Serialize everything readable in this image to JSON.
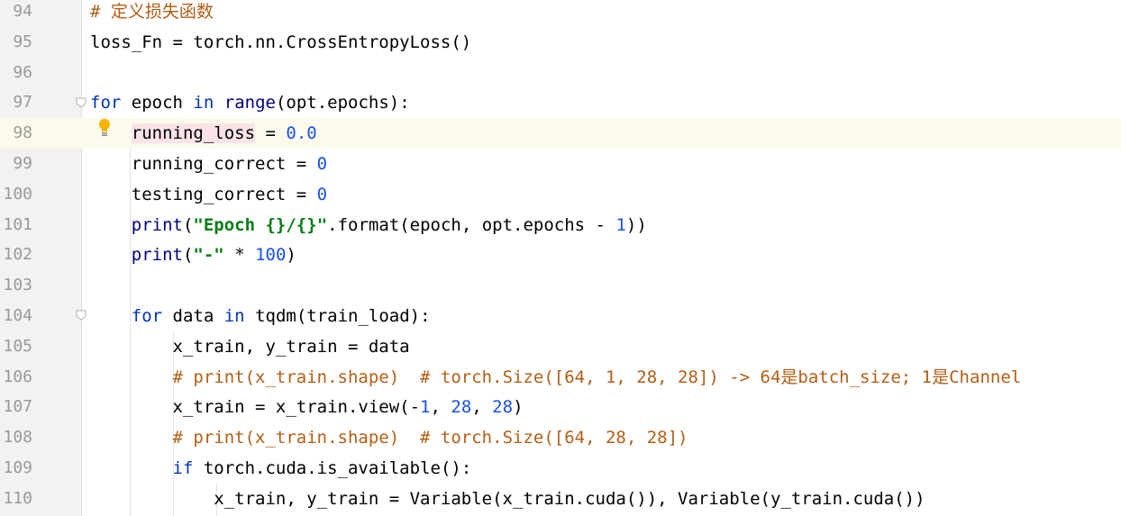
{
  "editor": {
    "lines": [
      {
        "no": "94",
        "tokens": [
          {
            "t": "# 定义损失函数",
            "c": "cm"
          }
        ]
      },
      {
        "no": "95",
        "tokens": [
          {
            "t": "loss_Fn = torch.nn.CrossEntropyLoss()",
            "c": ""
          }
        ]
      },
      {
        "no": "96",
        "tokens": []
      },
      {
        "no": "97",
        "tokens": [
          {
            "t": "for",
            "c": "kw"
          },
          {
            "t": " epoch ",
            "c": ""
          },
          {
            "t": "in",
            "c": "kw"
          },
          {
            "t": " ",
            "c": ""
          },
          {
            "t": "range",
            "c": "fn"
          },
          {
            "t": "(opt.epochs):",
            "c": ""
          }
        ]
      },
      {
        "no": "98",
        "tokens": [
          {
            "t": "    ",
            "c": ""
          },
          {
            "t": "running_loss",
            "c": "hl"
          },
          {
            "t": " = ",
            "c": ""
          },
          {
            "t": "0.0",
            "c": "num"
          }
        ]
      },
      {
        "no": "99",
        "tokens": [
          {
            "t": "    running_correct = ",
            "c": ""
          },
          {
            "t": "0",
            "c": "num"
          }
        ]
      },
      {
        "no": "100",
        "tokens": [
          {
            "t": "    testing_correct = ",
            "c": ""
          },
          {
            "t": "0",
            "c": "num"
          }
        ]
      },
      {
        "no": "101",
        "tokens": [
          {
            "t": "    ",
            "c": ""
          },
          {
            "t": "print",
            "c": "fn"
          },
          {
            "t": "(",
            "c": ""
          },
          {
            "t": "\"Epoch {}/{}\"",
            "c": "str"
          },
          {
            "t": ".format(epoch, opt.epochs - ",
            "c": ""
          },
          {
            "t": "1",
            "c": "num"
          },
          {
            "t": "))",
            "c": ""
          }
        ]
      },
      {
        "no": "102",
        "tokens": [
          {
            "t": "    ",
            "c": ""
          },
          {
            "t": "print",
            "c": "fn"
          },
          {
            "t": "(",
            "c": ""
          },
          {
            "t": "\"-\"",
            "c": "str"
          },
          {
            "t": " * ",
            "c": ""
          },
          {
            "t": "100",
            "c": "num"
          },
          {
            "t": ")",
            "c": ""
          }
        ]
      },
      {
        "no": "103",
        "tokens": []
      },
      {
        "no": "104",
        "tokens": [
          {
            "t": "    ",
            "c": ""
          },
          {
            "t": "for",
            "c": "kw"
          },
          {
            "t": " data ",
            "c": ""
          },
          {
            "t": "in",
            "c": "kw"
          },
          {
            "t": " tqdm(train_load):",
            "c": ""
          }
        ]
      },
      {
        "no": "105",
        "tokens": [
          {
            "t": "        x_train, y_train = data",
            "c": ""
          }
        ]
      },
      {
        "no": "106",
        "tokens": [
          {
            "t": "        ",
            "c": ""
          },
          {
            "t": "# print(x_train.shape)  # torch.Size([64, 1, 28, 28]) -> 64是batch_size; 1是Channel",
            "c": "cm"
          }
        ]
      },
      {
        "no": "107",
        "tokens": [
          {
            "t": "        x_train = x_train.view(-",
            "c": ""
          },
          {
            "t": "1",
            "c": "num"
          },
          {
            "t": ", ",
            "c": ""
          },
          {
            "t": "28",
            "c": "num"
          },
          {
            "t": ", ",
            "c": ""
          },
          {
            "t": "28",
            "c": "num"
          },
          {
            "t": ")",
            "c": ""
          }
        ]
      },
      {
        "no": "108",
        "tokens": [
          {
            "t": "        ",
            "c": ""
          },
          {
            "t": "# print(x_train.shape)  # torch.Size([64, 28, 28])",
            "c": "cm"
          }
        ]
      },
      {
        "no": "109",
        "tokens": [
          {
            "t": "        ",
            "c": ""
          },
          {
            "t": "if",
            "c": "kw"
          },
          {
            "t": " torch.cuda.is_available():",
            "c": ""
          }
        ]
      },
      {
        "no": "110",
        "tokens": [
          {
            "t": "            x_train, y_train = Variable(x_train.cuda()), Variable(y_train.cuda())",
            "c": ""
          }
        ]
      }
    ],
    "current_line": "98"
  }
}
